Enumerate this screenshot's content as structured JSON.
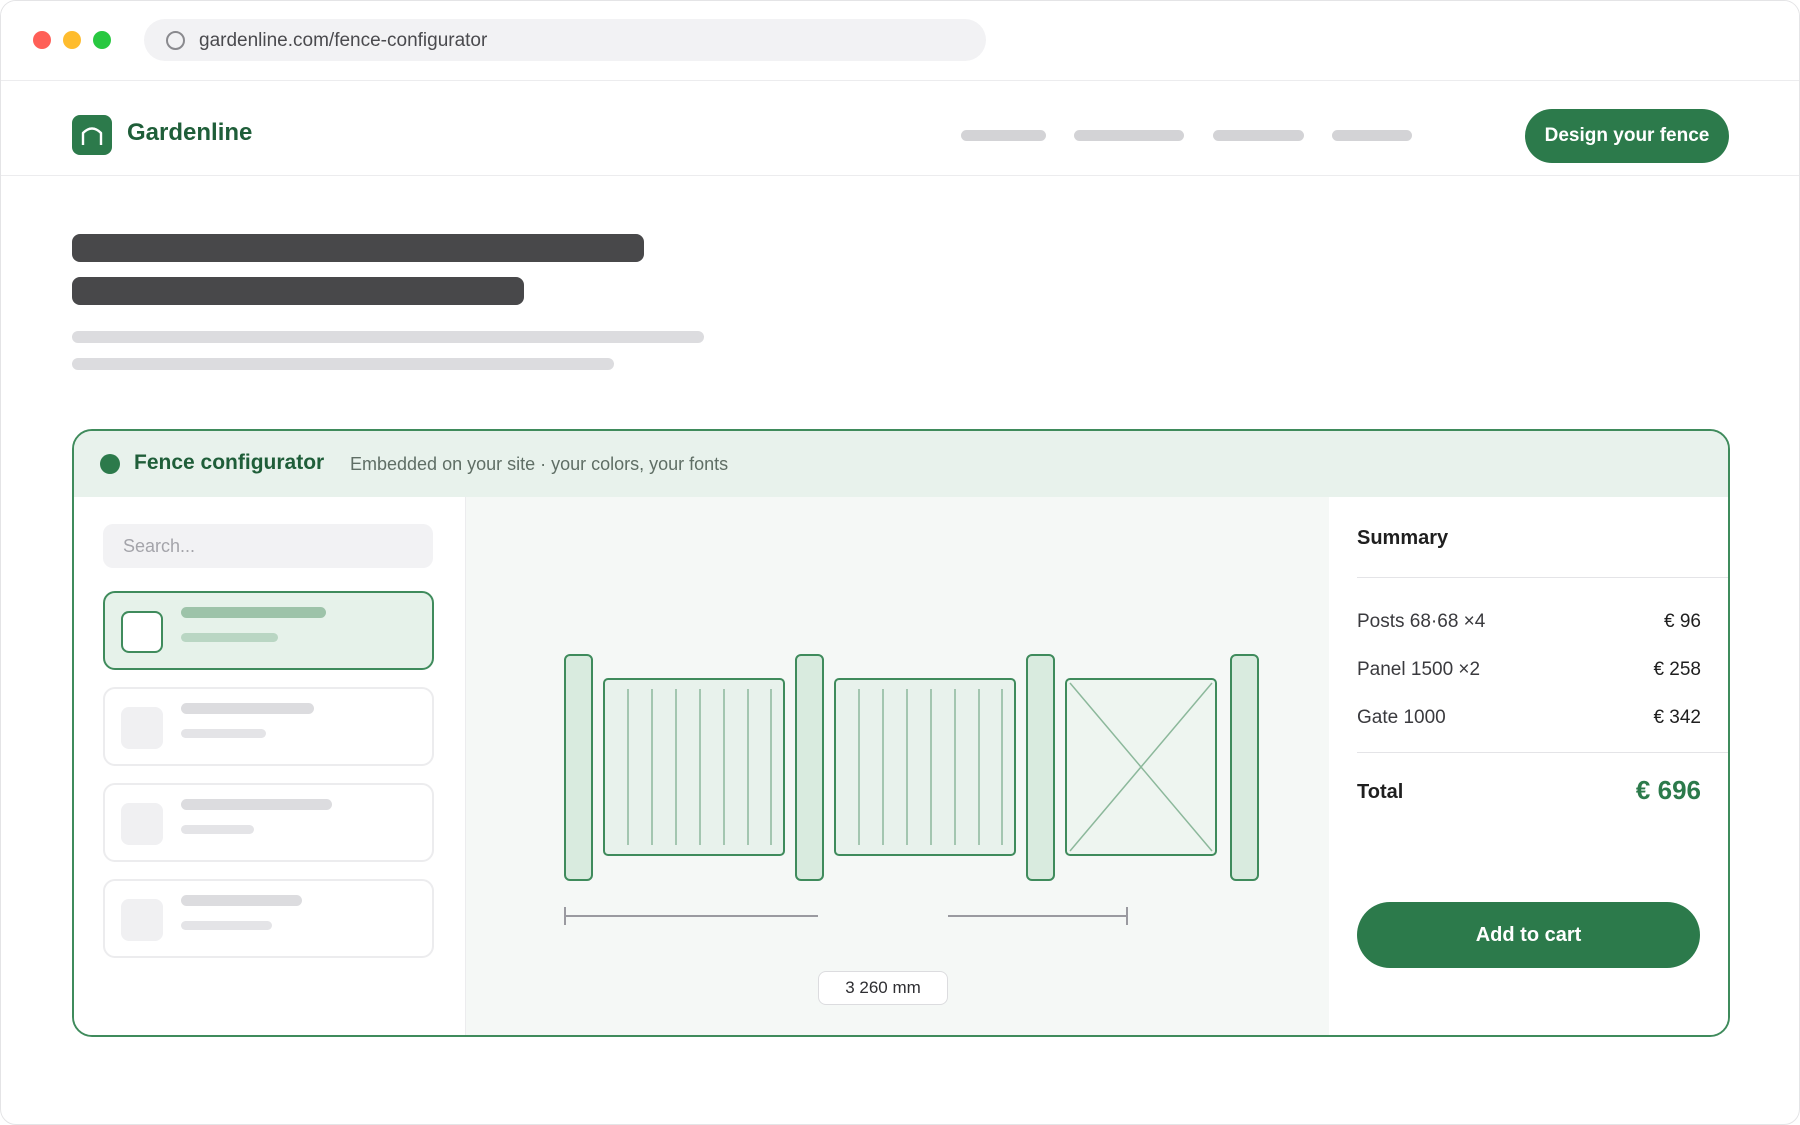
{
  "browser": {
    "url": "gardenline.com/fence-configurator"
  },
  "site": {
    "brand": "Gardenline",
    "cta_label": "Design your fence"
  },
  "widget": {
    "title": "Fence configurator",
    "subtitle": "Embedded on your site · your colors, your fonts",
    "search_placeholder": "Search...",
    "selected_option_index": 0,
    "dimension_label": "3 260 mm",
    "summary": {
      "title": "Summary",
      "items": [
        {
          "label": "Posts 68·68 ×4",
          "amount": "€ 96"
        },
        {
          "label": "Panel 1500 ×2",
          "amount": "€ 258"
        },
        {
          "label": "Gate 1000",
          "amount": "€ 342"
        }
      ],
      "total_label": "Total",
      "total_amount": "€ 696",
      "add_to_cart_label": "Add to cart"
    }
  },
  "colors": {
    "brand_green": "#2c7a4b",
    "brand_green_light": "#e8f2ec"
  }
}
